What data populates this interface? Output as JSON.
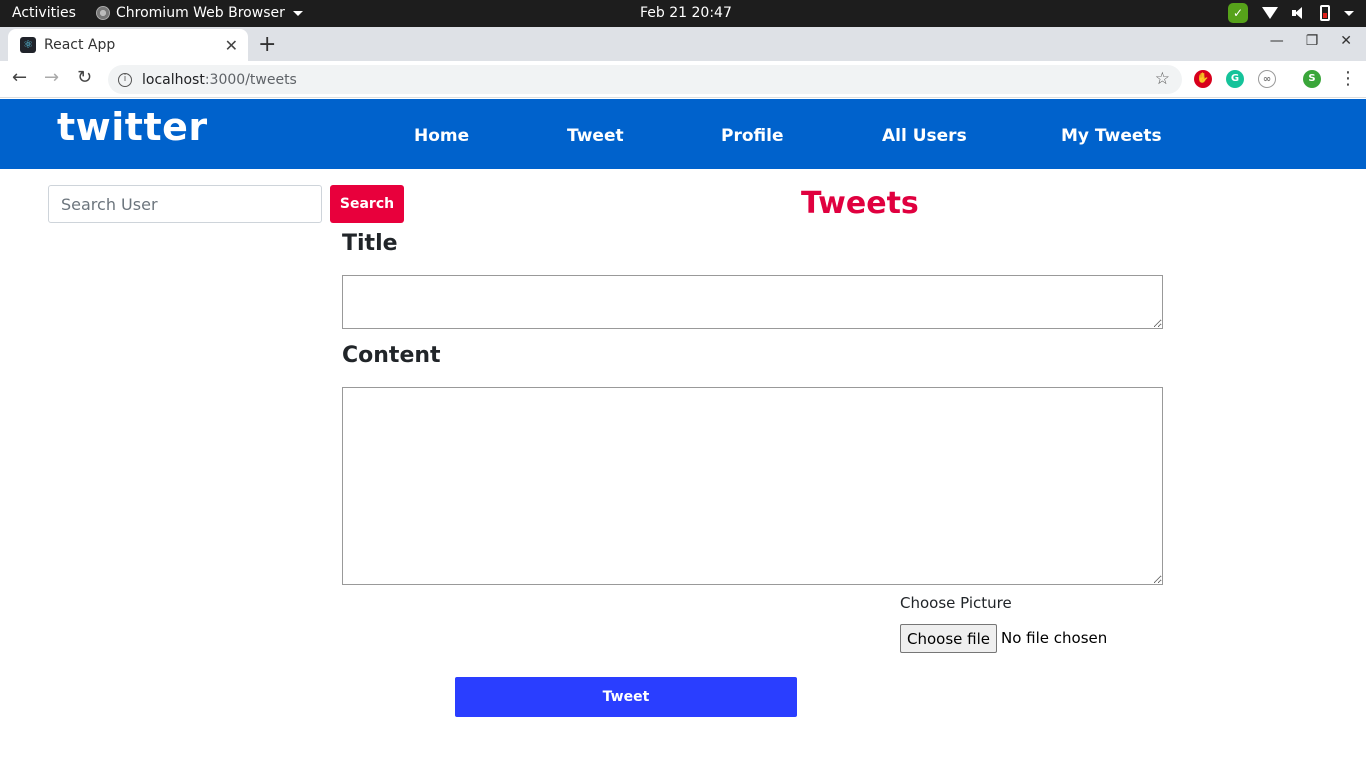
{
  "system": {
    "activities": "Activities",
    "app_menu": "Chromium Web Browser",
    "clock": "Feb 21  20:47"
  },
  "browser": {
    "tab_title": "React App",
    "url_host": "localhost",
    "url_path": ":3000/tweets",
    "profile_initial": "S"
  },
  "app": {
    "logo": "twitter",
    "nav": [
      "Home",
      "Tweet",
      "Profile",
      "All Users",
      "My Tweets"
    ],
    "search": {
      "placeholder": "Search User",
      "button": "Search"
    },
    "heading": "Tweets",
    "form": {
      "title_label": "Title",
      "content_label": "Content",
      "picture_label": "Choose Picture",
      "file_button": "Choose file",
      "file_status": "No file chosen",
      "submit": "Tweet"
    }
  },
  "colors": {
    "navbar": "#0062cc",
    "search_button": "#e8003c",
    "heading": "#e0003f",
    "submit_button": "#2a3eff"
  }
}
